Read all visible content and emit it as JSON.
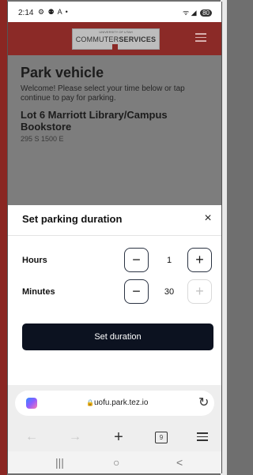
{
  "status": {
    "time": "2:14",
    "icons": "⚙ ⚉ A •",
    "signal": "ᯤ ◢",
    "battery": "80"
  },
  "header": {
    "logo_small": "UNIVERSITY OF UTAH",
    "logo_left": "COMMUTER",
    "logo_right": "SERVICES"
  },
  "page": {
    "title": "Park vehicle",
    "welcome": "Welcome! Please select your time below or tap continue to pay for parking.",
    "lot_name": "Lot 6 Marriott Library/Campus Bookstore",
    "lot_address": "295 S 1500 E"
  },
  "sheet": {
    "title": "Set parking duration",
    "close": "×",
    "hours_label": "Hours",
    "hours_value": "1",
    "minutes_label": "Minutes",
    "minutes_value": "30",
    "minus": "−",
    "plus": "+",
    "button": "Set duration"
  },
  "browser": {
    "url": "uofu.park.tez.io",
    "lock": "🔒",
    "reload": "↻",
    "back": "←",
    "forward": "→",
    "new_tab": "+",
    "tab_count": "9"
  },
  "sysnav": {
    "recents": "|||",
    "home": "○",
    "back": "<"
  },
  "colors": {
    "header": "#8b2a27",
    "button": "#0c1220"
  }
}
